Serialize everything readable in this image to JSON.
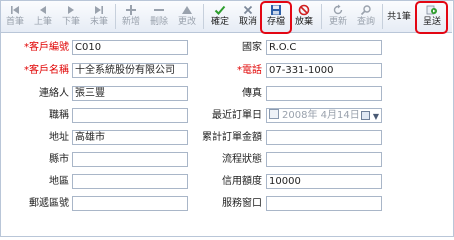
{
  "toolbar": {
    "first": "首筆",
    "prev": "上筆",
    "next": "下筆",
    "last": "末筆",
    "add": "新增",
    "delete": "刪除",
    "edit": "更改",
    "confirm": "確定",
    "cancel": "取消",
    "save": "存檔",
    "abandon": "放棄",
    "refresh": "更新",
    "query": "查詢",
    "count": "共1筆",
    "submit": "呈送"
  },
  "form": {
    "customer_code_label": "*客戶編號",
    "customer_code": "C010",
    "country_label": "國家",
    "country": "R.O.C",
    "customer_name_label": "*客戶名稱",
    "customer_name": "十全系統股份有限公司",
    "phone_label": "*電話",
    "phone": "07-331-1000",
    "contact_label": "連絡人",
    "contact": "張三豐",
    "fax_label": "傳真",
    "fax": "",
    "title_label": "職稱",
    "title": "",
    "last_order_date_label": "最近訂單日",
    "last_order_date": "2008年 4月14日",
    "address_label": "地址",
    "address": "高雄市",
    "total_order_label": "累計訂單金額",
    "total_order": "",
    "city_label": "縣市",
    "city": "",
    "flow_status_label": "流程狀態",
    "flow_status": "",
    "district_label": "地區",
    "district": "",
    "credit_limit_label": "信用額度",
    "credit_limit": "10000",
    "postal_code_label": "郵遞區號",
    "postal_code": "",
    "service_window_label": "服務窗口",
    "service_window": ""
  },
  "colors": {
    "highlight": "#e30613",
    "required_label": "#e00000",
    "disabled_text": "#9aa2ad"
  }
}
